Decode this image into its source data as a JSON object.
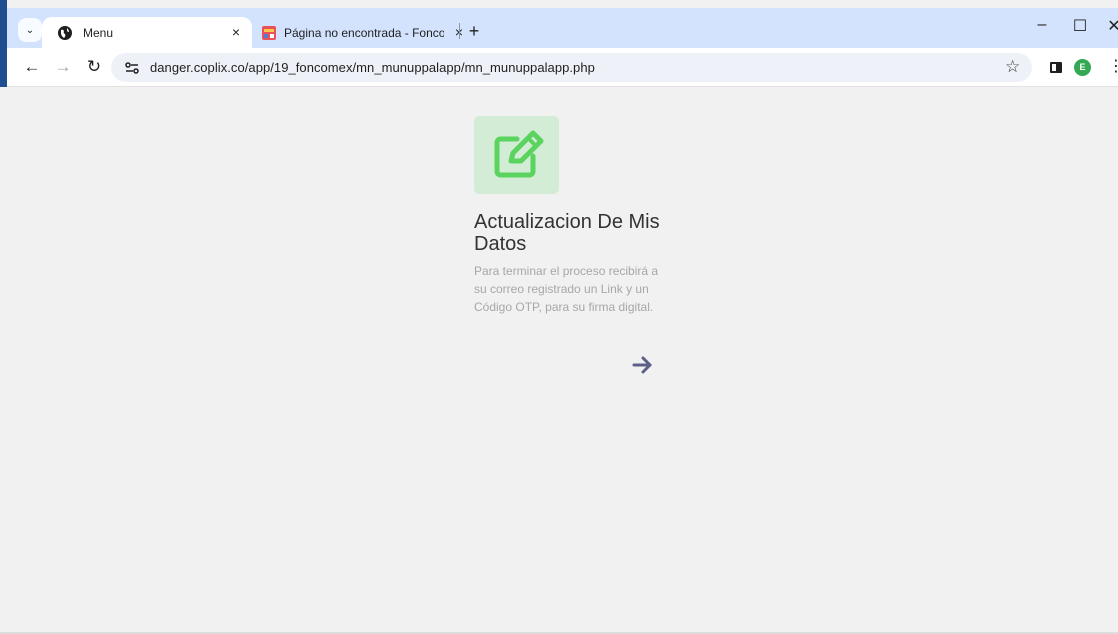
{
  "browser": {
    "tabs": [
      {
        "title": "Menu",
        "active": true,
        "favicon": "globe-icon"
      },
      {
        "title": "Página no encontrada - Foncom",
        "active": false,
        "favicon": "site-favicon"
      }
    ],
    "close_glyph": "×",
    "new_tab_glyph": "+",
    "url": "danger.coplix.co/app/19_foncomex/mn_munuppalapp/mn_munuppalapp.php",
    "profile_initial": "E",
    "window_controls": {
      "minimize": "–",
      "maximize": "☐",
      "close": "✕"
    }
  },
  "card": {
    "title": "Actualizacion De Mis Datos",
    "description": "Para terminar el proceso recibirá a su correo registrado un Link y un Código OTP, para su firma digital.",
    "icon": "edit-icon",
    "arrow": "arrow-right-icon"
  },
  "colors": {
    "tabbar": "#d3e3fd",
    "page_bg": "#f1f1f1",
    "icon_green": "#5ad35f",
    "icon_tile": "#d3ecd6",
    "arrow": "#5c5f86"
  }
}
